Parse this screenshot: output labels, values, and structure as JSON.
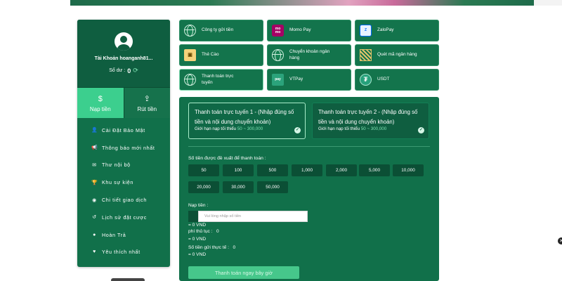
{
  "account": {
    "name": "Tài Khoản hoanganh81...",
    "balance_label": "Số dư :",
    "balance_value": "0"
  },
  "tabs": [
    {
      "label": "Nạp tiền",
      "active": true
    },
    {
      "label": "Rút tiền",
      "active": false
    }
  ],
  "menu": [
    {
      "label": "Cài Đặt Bảo Mật",
      "icon": "user-lock-icon"
    },
    {
      "label": "Thông báo mới nhất",
      "icon": "megaphone-icon"
    },
    {
      "label": "Thư nội bộ",
      "icon": "envelope-icon"
    },
    {
      "label": "Khu sự kiện",
      "icon": "trophy-icon"
    },
    {
      "label": "Chi tiết giao dịch",
      "icon": "list-icon"
    },
    {
      "label": "Lịch sử đặt cược",
      "icon": "history-icon"
    },
    {
      "label": "Hoàn Trả",
      "icon": "refund-icon"
    },
    {
      "label": "Yêu thích nhất",
      "icon": "heart-icon"
    }
  ],
  "payment_methods": [
    {
      "label": "Công ty gửi tiền",
      "icon": "globe-icon"
    },
    {
      "label": "Momo Pay",
      "icon": "momo-icon"
    },
    {
      "label": "ZaloPay",
      "icon": "zalopay-icon"
    },
    {
      "label": "Thẻ Cào",
      "icon": "card-icon"
    },
    {
      "label": "Chuyển khoản ngân hàng",
      "icon": "globe-icon"
    },
    {
      "label": "Quét mã ngân hàng",
      "icon": "qr-icon"
    },
    {
      "label": "Thanh toán trực tuyến",
      "icon": "globe-icon",
      "selected": true
    },
    {
      "label": "VTPay",
      "icon": "vtpay-icon"
    },
    {
      "label": "USDT",
      "icon": "usdt-icon"
    }
  ],
  "channels": [
    {
      "title": "Thanh toán trực tuyến 1 - (Nhập đúng số tiền và nội dung chuyển khoản)",
      "limit_label": "Giới hạn nạp tối thiểu",
      "limit_value": "50 ~ 300,000",
      "selected": true
    },
    {
      "title": "Thanh toán trực tuyến 2 - (Nhập đúng số tiền và nội dung chuyển khoản)",
      "limit_label": "Giới hạn nạp tối thiểu",
      "limit_value": "50 ~ 300,000",
      "selected": false
    }
  ],
  "suggest_title": "Số tiền được đề xuất để thanh toán :",
  "amounts": [
    "50",
    "100",
    "500",
    "1,000",
    "2,000",
    "5,000",
    "10,000",
    "20,000",
    "30,000",
    "50,000"
  ],
  "deposit": {
    "label": "Nạp tiền :",
    "placeholder": "Vui lòng nhập số tiền",
    "eq1": "= 0 VND",
    "fee_label": "phí thủ tục :",
    "fee_value": "0",
    "eq2": "= 0 VND",
    "actual_label": "Số tiền gửi thực tế :",
    "actual_value": "0",
    "eq3": "= 0 VND",
    "submit_label": "Thanh toán ngay bây giờ"
  },
  "colors": {
    "primary": "#11704a",
    "accent": "#3ccf8e",
    "highlight": "#7fe3b4"
  }
}
